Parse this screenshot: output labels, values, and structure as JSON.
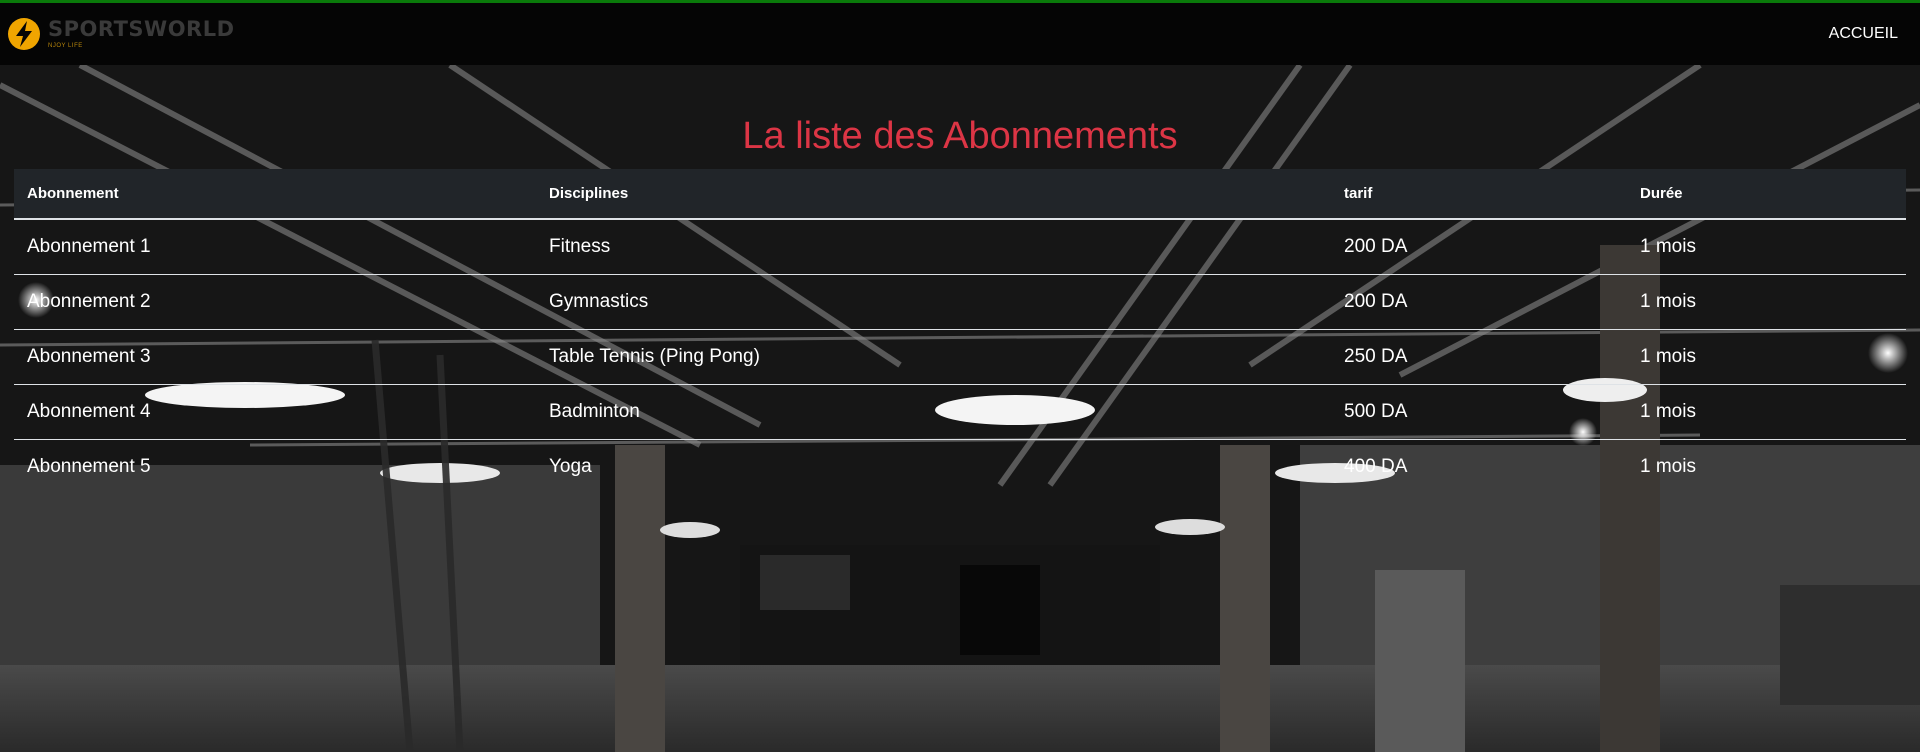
{
  "brand": {
    "name": "SPORTSWORLD",
    "tagline": "NJOY LIFE",
    "logo_icon": "lightning-bolt-circle-icon"
  },
  "nav": {
    "links": [
      {
        "label": "ACCUEIL"
      }
    ]
  },
  "page": {
    "title": "La liste des Abonnements"
  },
  "table": {
    "headers": [
      "Abonnement",
      "Disciplines",
      "tarif",
      "Durée"
    ],
    "rows": [
      [
        "Abonnement 1",
        "Fitness",
        "200 DA",
        "1 mois"
      ],
      [
        "Abonnement 2",
        "Gymnastics",
        "200 DA",
        "1 mois"
      ],
      [
        "Abonnement 3",
        "Table Tennis (Ping Pong)",
        "250 DA",
        "1 mois"
      ],
      [
        "Abonnement 4",
        "Badminton",
        "500 DA",
        "1 mois"
      ],
      [
        "Abonnement 5",
        "Yoga",
        "400 DA",
        "1 mois"
      ]
    ]
  },
  "colors": {
    "title": "#dc3545",
    "header_bg": "#212529",
    "accent_top": "#0a7a0a",
    "logo": "#f0a500"
  }
}
